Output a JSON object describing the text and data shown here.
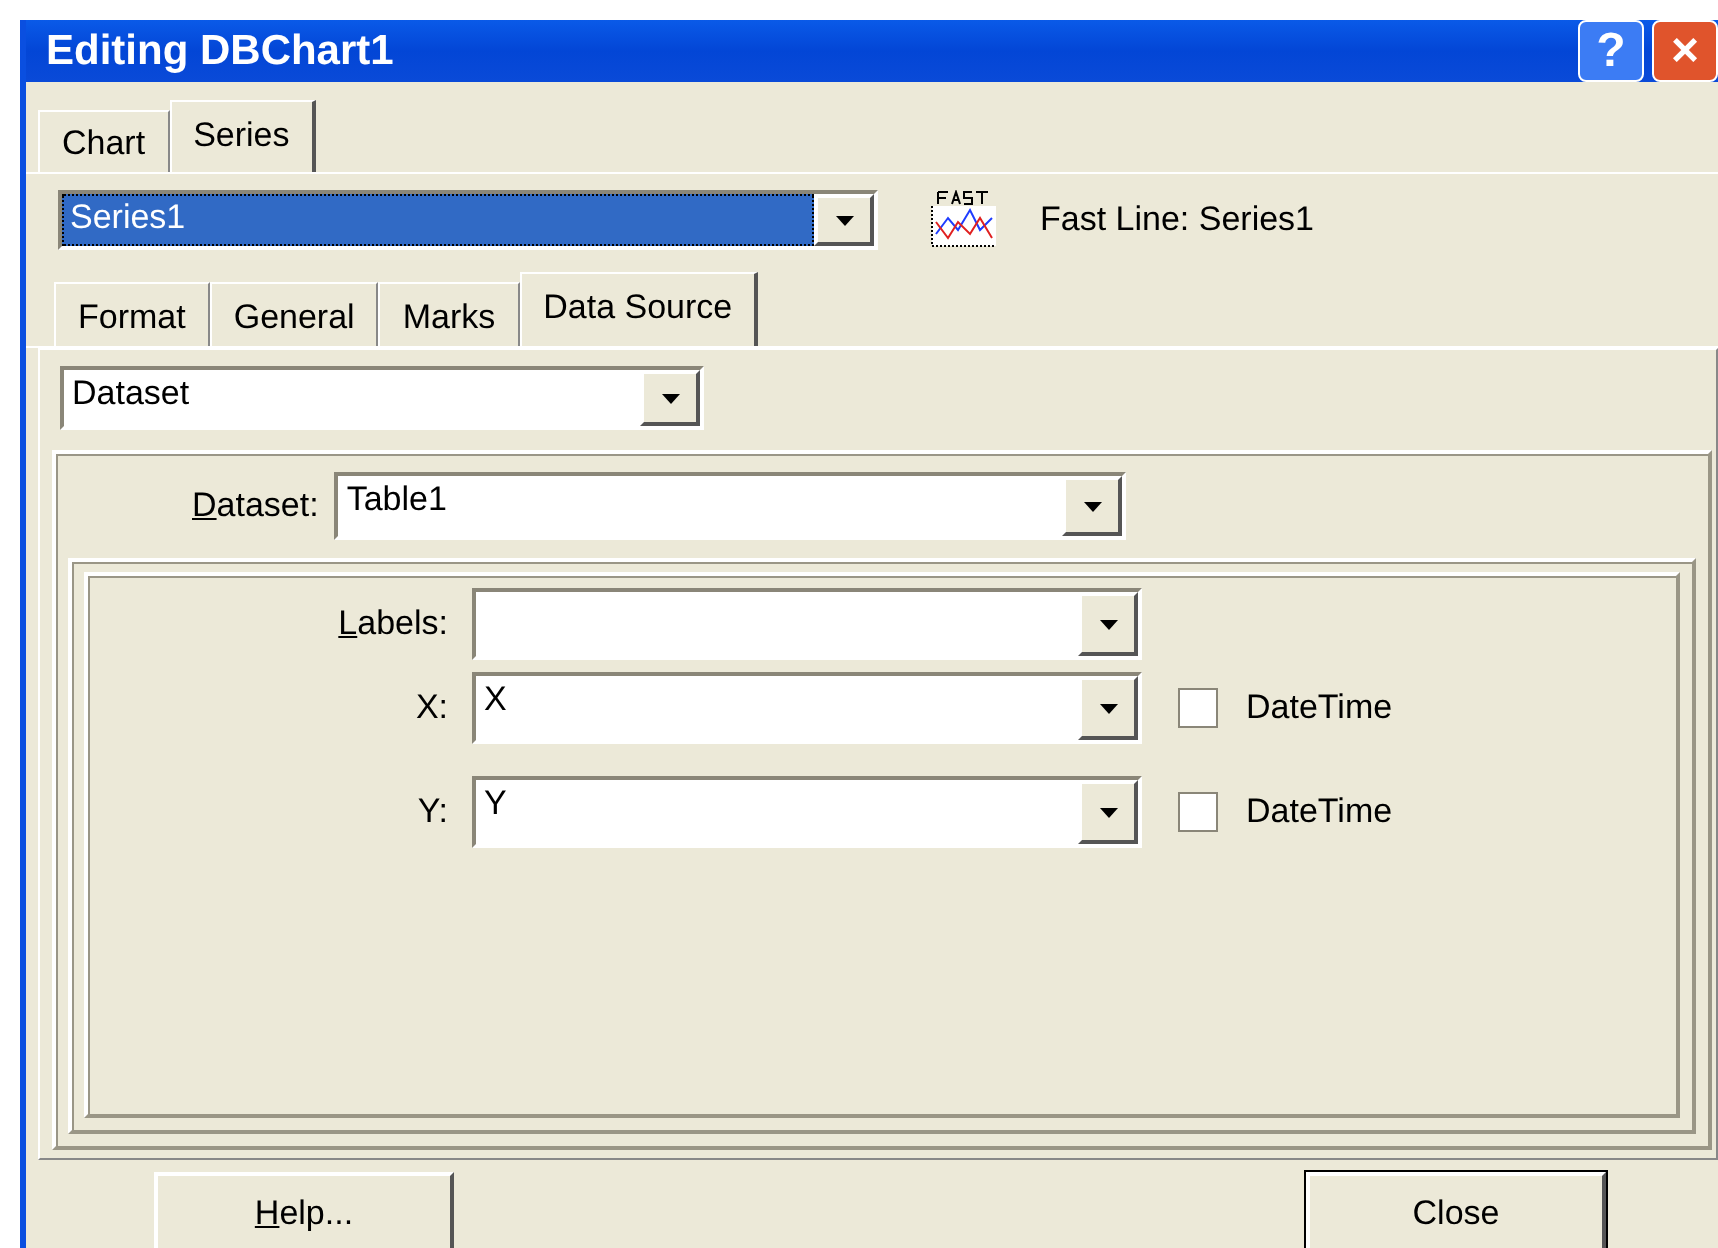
{
  "window": {
    "title": "Editing DBChart1",
    "help_button": "?",
    "close_button": "×"
  },
  "tabs": [
    {
      "label": "Chart",
      "selected": false
    },
    {
      "label": "Series",
      "selected": true
    }
  ],
  "series_select": {
    "value": "Series1"
  },
  "series_info": "Fast Line: Series1",
  "series_tabs": [
    {
      "label": "Format",
      "selected": false
    },
    {
      "label": "General",
      "selected": false
    },
    {
      "label": "Marks",
      "selected": false
    },
    {
      "label": "Data Source",
      "selected": true
    }
  ],
  "source_select": {
    "value": "Dataset"
  },
  "dataset": {
    "label": "Dataset:",
    "mnemonic": true,
    "value": "Table1"
  },
  "fields": [
    {
      "label": "Labels:",
      "mnemonic": true
    },
    {
      "label": "X:",
      "mnemonic": false,
      "value": "X",
      "checkbox": {
        "label": "DateTime",
        "checked": false
      }
    },
    {
      "label": "Y:",
      "mnemonic": false,
      "value": "Y",
      "checkbox": {
        "label": "DateTime",
        "checked": false
      }
    }
  ],
  "buttons": [
    {
      "label": "Help...",
      "mnemonic": true,
      "default": false
    },
    {
      "label": "Close",
      "mnemonic": false,
      "default": true
    }
  ]
}
